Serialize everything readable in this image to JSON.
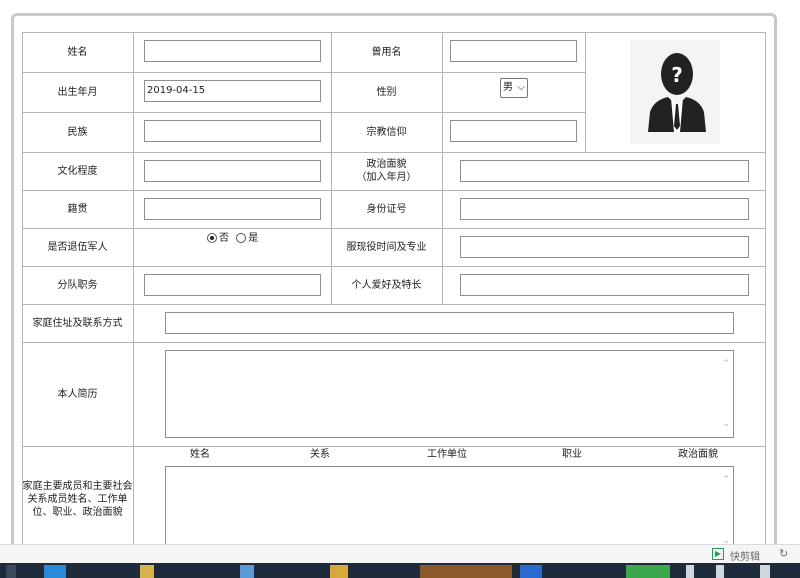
{
  "form": {
    "name_label": "姓名",
    "former_name_label": "曾用名",
    "birth_label": "出生年月",
    "birth_value": "2019-04-15",
    "gender_label": "性别",
    "gender_value": "男",
    "ethnicity_label": "民族",
    "religion_label": "宗教信仰",
    "education_label": "文化程度",
    "political_label": "政治面貌\n（加入年月）",
    "native_label": "籍贯",
    "id_label": "身份证号",
    "veteran_label": "是否退伍军人",
    "veteran_no": "否",
    "veteran_yes": "是",
    "service_label": "服现役时间及专业",
    "squad_label": "分队职务",
    "hobby_label": "个人爱好及特长",
    "address_label": "家庭住址及联系方式",
    "resume_label": "本人简历",
    "family_label": "家庭主要成员和主要社会\n关系成员姓名、工作单\n位、职业、政治面貌",
    "family_columns": [
      "姓名",
      "关系",
      "工作单位",
      "职业",
      "政治面貌"
    ]
  },
  "status_bar": {
    "app_label": "快剪辑"
  }
}
